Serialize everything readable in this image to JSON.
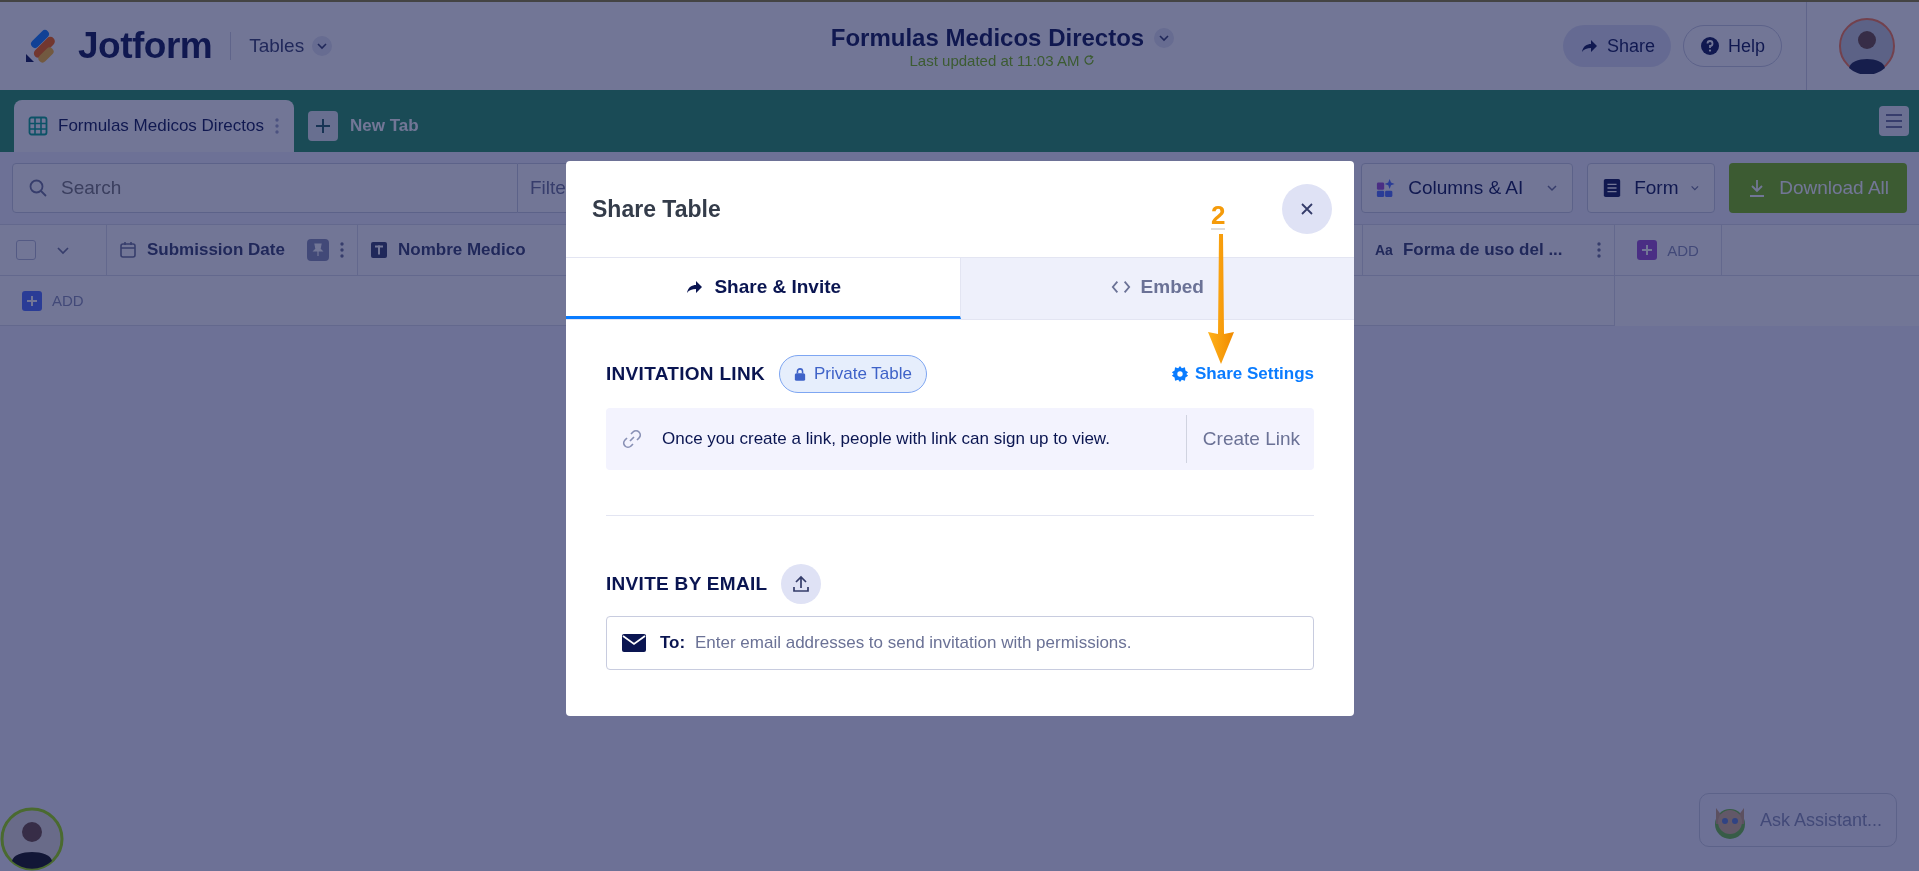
{
  "header": {
    "logo": "Jotform",
    "product": "Tables",
    "title": "Formulas Medicos Directos",
    "updated": "Last updated at 11:03 AM",
    "share": "Share",
    "help": "Help"
  },
  "tabs": [
    {
      "label": "Formulas Medicos Directos",
      "selected": true
    }
  ],
  "new_tab": "New Tab",
  "toolbar": {
    "search_placeholder": "Search",
    "filter": "Filte",
    "columns": "Columns & AI",
    "form": "Form",
    "download": "Download All"
  },
  "table": {
    "select_all": {
      "checked": false
    },
    "columns": [
      {
        "label": "Submission Date",
        "kind": "date",
        "pinned": true
      },
      {
        "label": "Nombre Medico",
        "kind": "text",
        "pinned": false
      },
      {
        "label": "Forma de uso del ...",
        "kind": "short",
        "badge": "Aa",
        "pinned": false
      }
    ],
    "add_column": "ADD",
    "add_row": "ADD"
  },
  "modal": {
    "title": "Share Table",
    "tabs": [
      {
        "label": "Share & Invite",
        "kind": "share",
        "selected": true
      },
      {
        "label": "Embed",
        "kind": "embed",
        "selected": false
      }
    ],
    "invitation_label": "INVITATION LINK",
    "privacy_badge": "Private Table",
    "share_settings": "Share Settings",
    "link_note": "Once you create a link, people with link can sign up to view.",
    "create_link": "Create Link",
    "invite_label": "INVITE BY EMAIL",
    "to_label": "To:",
    "email_placeholder": "Enter email addresses to send invitation with permissions."
  },
  "annotation": {
    "step": "2"
  },
  "assistant": "Ask Assistant..."
}
